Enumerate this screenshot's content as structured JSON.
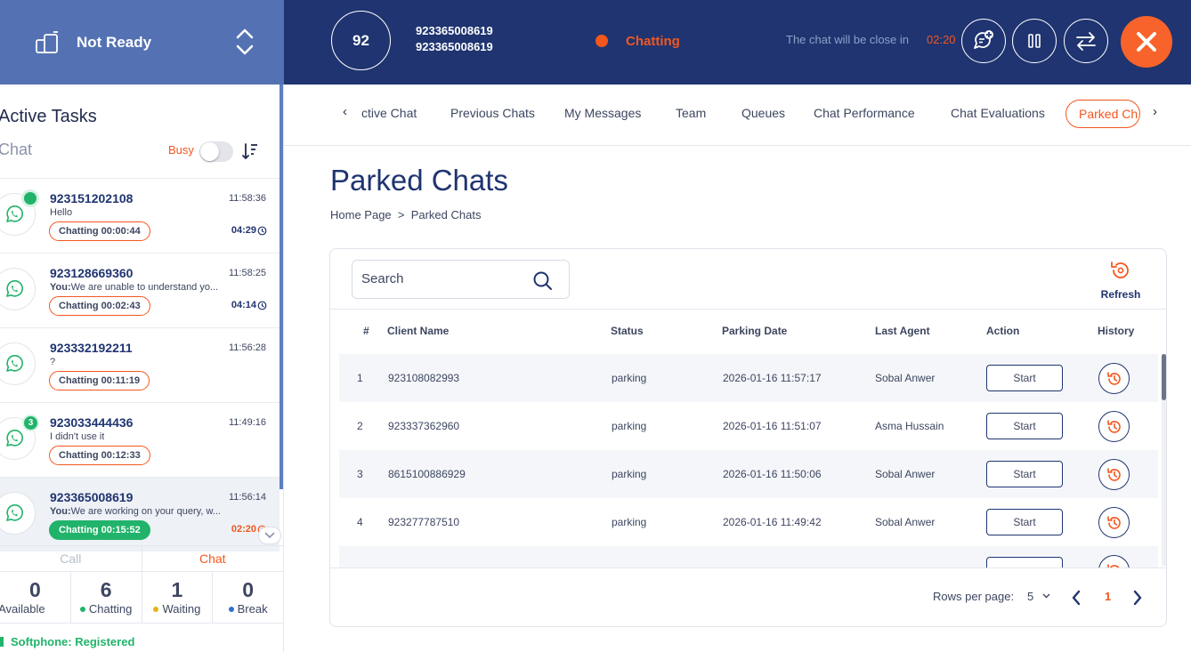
{
  "status": {
    "label": "Not Ready",
    "icon": "agent-status-icon"
  },
  "header": {
    "active_count": "92",
    "phone_primary": "923365008619",
    "phone_secondary": "923365008619",
    "chat_state": "Chatting",
    "close_message": "The chat will be close in",
    "close_timer": "02:20",
    "colors": {
      "header_bg": "#1f3470",
      "accent": "#f3571e",
      "status_bg": "#5472b3"
    }
  },
  "sidebar": {
    "title": "Active Tasks",
    "subtitle": "Chat",
    "busy_label": "Busy",
    "tasks": [
      {
        "number": "923151202108",
        "time": "11:58:36",
        "preview_prefix": "",
        "preview": "Hello",
        "pill": "Chatting 00:00:44",
        "duration": "04:29",
        "badge": ""
      },
      {
        "number": "923128669360",
        "time": "11:58:25",
        "preview_prefix": "You:",
        "preview": "We are unable to understand yo...",
        "pill": "Chatting 00:02:43",
        "duration": "04:14",
        "badge": ""
      },
      {
        "number": "923332192211",
        "time": "11:56:28",
        "preview_prefix": "",
        "preview": "?",
        "pill": "Chatting 00:11:19",
        "duration": "",
        "badge": ""
      },
      {
        "number": "923033444436",
        "time": "11:49:16",
        "preview_prefix": "",
        "preview": "I didn't use it",
        "pill": "Chatting 00:12:33",
        "duration": "",
        "badge": "3"
      },
      {
        "number": "923365008619",
        "time": "11:56:14",
        "preview_prefix": "You:",
        "preview": "We are working on your query, w...",
        "pill": "Chatting 00:15:52",
        "duration": "02:20",
        "badge": ""
      }
    ],
    "mode_tabs": [
      "Call",
      "Chat"
    ],
    "stats": [
      {
        "value": "0",
        "label": "Available",
        "color": ""
      },
      {
        "value": "6",
        "label": "Chatting",
        "color": "#21b36a"
      },
      {
        "value": "1",
        "label": "Waiting",
        "color": "#e3b514"
      },
      {
        "value": "0",
        "label": "Break",
        "color": "#2f6fd1"
      }
    ],
    "softphone": "Softphone: Registered"
  },
  "nav": {
    "tabs": [
      "ctive Chat",
      "Previous Chats",
      "My Messages",
      "Team",
      "Queues",
      "Chat Performance",
      "Chat Evaluations",
      "Parked Ch"
    ],
    "prev_arrow": "‹",
    "next_arrow": "›"
  },
  "page": {
    "title": "Parked Chats",
    "breadcrumb": "Home Page  >  Parked Chats",
    "search_placeholder": "Search",
    "refresh_label": "Refresh"
  },
  "table": {
    "columns": [
      "#",
      "Client Name",
      "Status",
      "Parking Date",
      "Last Agent",
      "Action",
      "History"
    ],
    "rows": [
      {
        "index": "1",
        "client": "923108082993",
        "status": "parking",
        "date": "2026-01-16 11:57:17",
        "agent": "Sobal Anwer",
        "action": "Start"
      },
      {
        "index": "2",
        "client": "923337362960",
        "status": "parking",
        "date": "2026-01-16 11:51:07",
        "agent": "Asma Hussain",
        "action": "Start"
      },
      {
        "index": "3",
        "client": "8615100886929",
        "status": "parking",
        "date": "2026-01-16 11:50:06",
        "agent": "Sobal Anwer",
        "action": "Start"
      },
      {
        "index": "4",
        "client": "923277787510",
        "status": "parking",
        "date": "2026-01-16 11:49:42",
        "agent": "Sobal Anwer",
        "action": "Start"
      }
    ],
    "rows_per_page_label": "Rows per page:",
    "rows_per_page": "5",
    "current_page": "1"
  }
}
